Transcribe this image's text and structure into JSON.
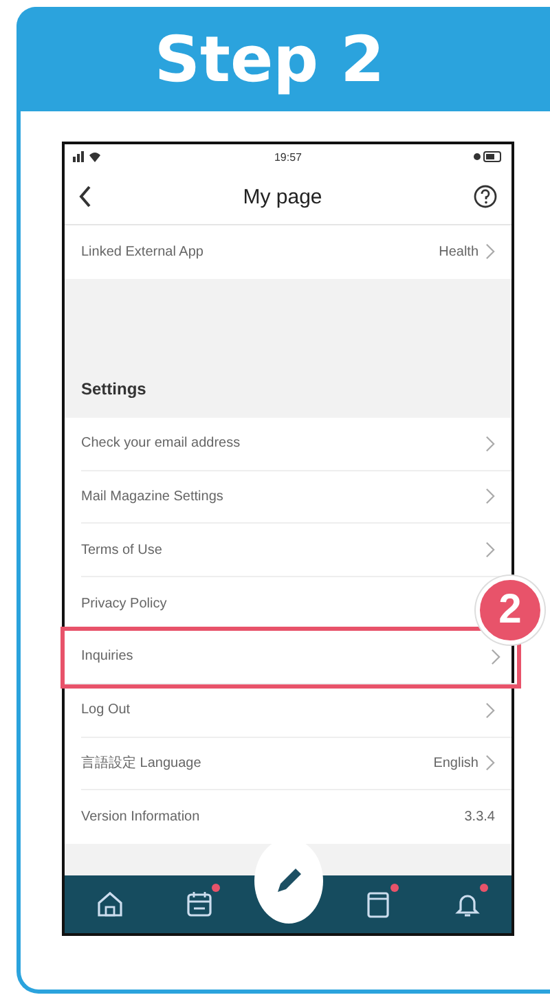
{
  "step": {
    "title": "Step 2"
  },
  "status_bar": {
    "time": "19:57"
  },
  "nav": {
    "title": "My page"
  },
  "linked": {
    "label": "Linked External App",
    "value": "Health"
  },
  "section": {
    "title": "Settings"
  },
  "rows": [
    {
      "label": "Check your email address",
      "chevron": true,
      "highlighted": false
    },
    {
      "label": "Mail Magazine Settings",
      "chevron": true,
      "highlighted": false
    },
    {
      "label": "Terms of Use",
      "chevron": true,
      "highlighted": false
    },
    {
      "label": "Privacy Policy",
      "chevron": false,
      "highlighted": false
    },
    {
      "label": "Inquiries",
      "chevron": true,
      "highlighted": true
    },
    {
      "label": "Log Out",
      "chevron": true,
      "highlighted": false
    },
    {
      "label": "言語設定 Language",
      "value": "English",
      "chevron": true,
      "highlighted": false
    },
    {
      "label": "Version Information",
      "value": "3.3.4",
      "chevron": false,
      "highlighted": false
    }
  ],
  "callout": {
    "number": "2"
  },
  "tabbar": [
    {
      "kind": "home",
      "dot": false
    },
    {
      "kind": "calendar",
      "dot": true
    },
    {
      "kind": "pen"
    },
    {
      "kind": "book",
      "dot": true
    },
    {
      "kind": "bell",
      "dot": true
    }
  ]
}
